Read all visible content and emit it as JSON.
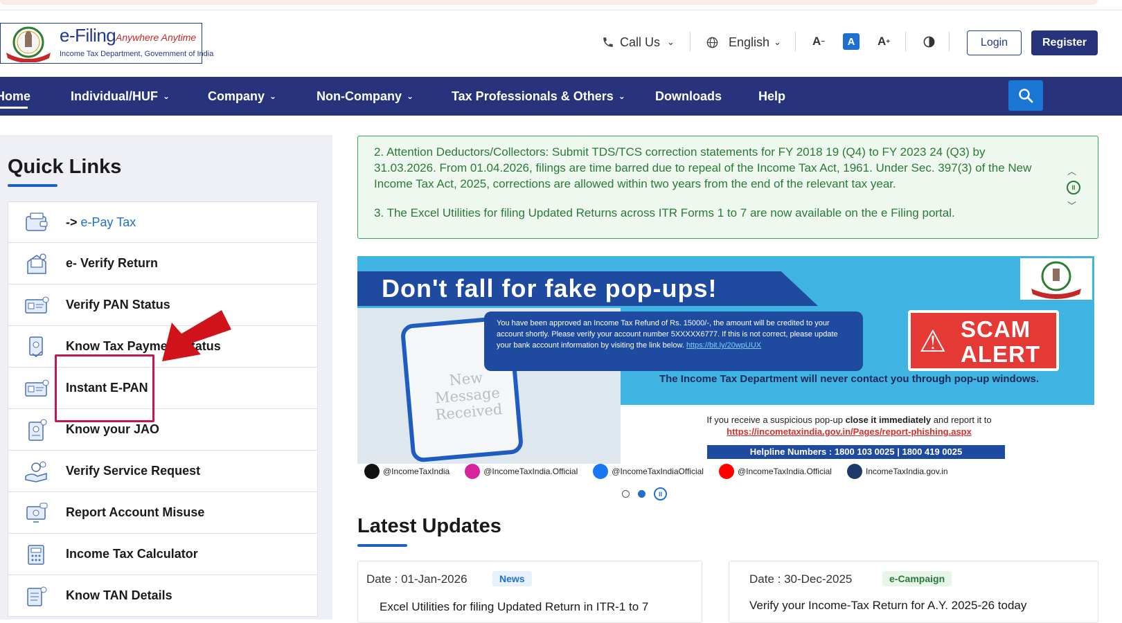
{
  "header": {
    "brand": "e-Filing",
    "tagline": "Anywhere Anytime",
    "subtitle": "Income Tax Department, Government of India",
    "call_us": "Call Us",
    "language": "English",
    "login": "Login",
    "register": "Register"
  },
  "nav": {
    "items": [
      "Home",
      "Individual/HUF",
      "Company",
      "Non-Company",
      "Tax Professionals & Others",
      "Downloads",
      "Help"
    ],
    "chevron": "⌄"
  },
  "quick_links": {
    "title": "Quick Links",
    "epay_prefix": "->",
    "epay_link": "e-Pay Tax",
    "items": [
      "e- Verify Return",
      "Verify PAN Status",
      "Know Tax Payment Status",
      "Instant E-PAN",
      "Know your JAO",
      "Verify Service Request",
      "Report Account Misuse",
      "Income Tax Calculator",
      "Know TAN Details"
    ]
  },
  "ticker": {
    "line1": "2.  Attention Deductors/Collectors: Submit TDS/TCS correction statements for FY 2018 19 (Q4) to FY 2023 24 (Q3) by 31.03.2026. From 01.04.2026, filings are time barred due to repeal of the Income Tax Act, 1961. Under Sec. 397(3) of the New Income Tax Act, 2025, corrections are allowed within two years from the end of the relevant tax year.",
    "line2": "3. The Excel Utilities for filing Updated Returns across ITR Forms 1 to 7 are now available on the e Filing portal."
  },
  "banner": {
    "headline": "Don't fall for fake pop-ups!",
    "phone_text": "New Message Received",
    "bubble_text": "You have been approved an Income Tax Refund of Rs. 15000/-, the amount will be credited to your account shortly. Please verify your account number 5XXXXX6777. If this is not correct, please update your bank account information by visiting the link below.",
    "bubble_link": "https://bit.ly/20wpUUX",
    "scam_line1": "SCAM",
    "scam_line2": "ALERT",
    "never_contact": "The Income Tax Department will never contact you through pop-up windows.",
    "report_prefix": "If you receive a suspicious pop-up",
    "report_bold": "close it immediately",
    "report_suffix": "and report it to",
    "report_link": "https://incometaxindia.gov.in/Pages/report-phishing.aspx",
    "helpline": "Helpline Numbers : 1800 103 0025 | 1800 419 0025",
    "social": [
      {
        "handle": "@IncomeTaxIndia",
        "color": "#111111"
      },
      {
        "handle": "@IncomeTaxIndia.Official",
        "color": "#d6249f"
      },
      {
        "handle": "@IncomeTaxIndiaOfficial",
        "color": "#1877f2"
      },
      {
        "handle": "@IncomeTaxIndia.Official",
        "color": "#ff0000"
      },
      {
        "handle": "IncomeTaxIndia.gov.in",
        "color": "#1e3a6a"
      }
    ]
  },
  "latest_updates": {
    "title": "Latest Updates",
    "cards": [
      {
        "date": "Date : 01-Jan-2026",
        "badge": "News",
        "title": "Excel Utilities for filing Updated Return in ITR-1 to 7"
      },
      {
        "date": "Date : 30-Dec-2025",
        "badge": "e-Campaign",
        "title": "Verify your Income-Tax Return for A.Y. 2025-26 today"
      }
    ]
  },
  "colors": {
    "nav_bg": "#27337a",
    "accent_blue": "#1f6fd1",
    "ticker_green": "#2a7a37",
    "highlight_red": "#c2184b"
  }
}
